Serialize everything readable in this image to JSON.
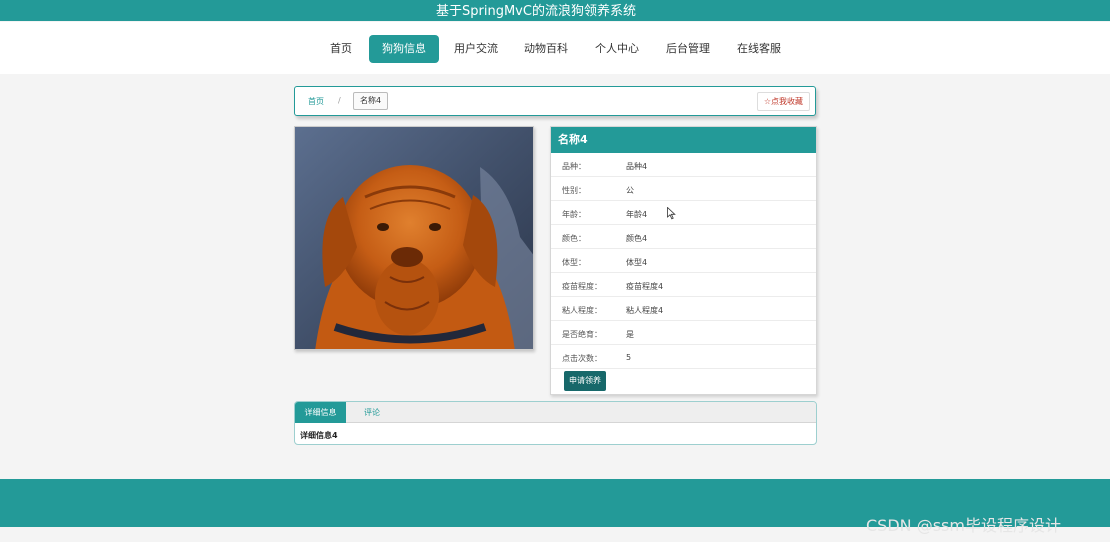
{
  "app": {
    "title": "基于SpringMvC的流浪狗领养系统"
  },
  "nav": {
    "items": [
      {
        "label": "首页"
      },
      {
        "label": "狗狗信息"
      },
      {
        "label": "用户交流"
      },
      {
        "label": "动物百科"
      },
      {
        "label": "个人中心"
      },
      {
        "label": "后台管理"
      },
      {
        "label": "在线客服"
      }
    ],
    "active_index": 1
  },
  "breadcrumb": {
    "home": "首页",
    "separator": "/",
    "current": "名称4"
  },
  "favorite": {
    "icon": "star-outline-icon",
    "label": "☆点我收藏"
  },
  "detail": {
    "title": "名称4",
    "fields": [
      {
        "key": "品种：",
        "value": "品种4"
      },
      {
        "key": "性别：",
        "value": "公"
      },
      {
        "key": "年龄：",
        "value": "年龄4"
      },
      {
        "key": "颜色：",
        "value": "颜色4"
      },
      {
        "key": "体型：",
        "value": "体型4"
      },
      {
        "key": "疫苗程度：",
        "value": "疫苗程度4"
      },
      {
        "key": "粘人程度：",
        "value": "粘人程度4"
      },
      {
        "key": "是否绝育：",
        "value": "是"
      },
      {
        "key": "点击次数：",
        "value": "5"
      }
    ],
    "apply_label": "申请领养"
  },
  "tabs": {
    "items": [
      {
        "label": "详细信息"
      },
      {
        "label": "评论"
      }
    ],
    "content": "详细信息4"
  },
  "watermark": "CSDN @ssm毕设程序设计",
  "colors": {
    "accent": "#239a98",
    "apply_button": "#17686a",
    "favorite": "#c0392b"
  }
}
